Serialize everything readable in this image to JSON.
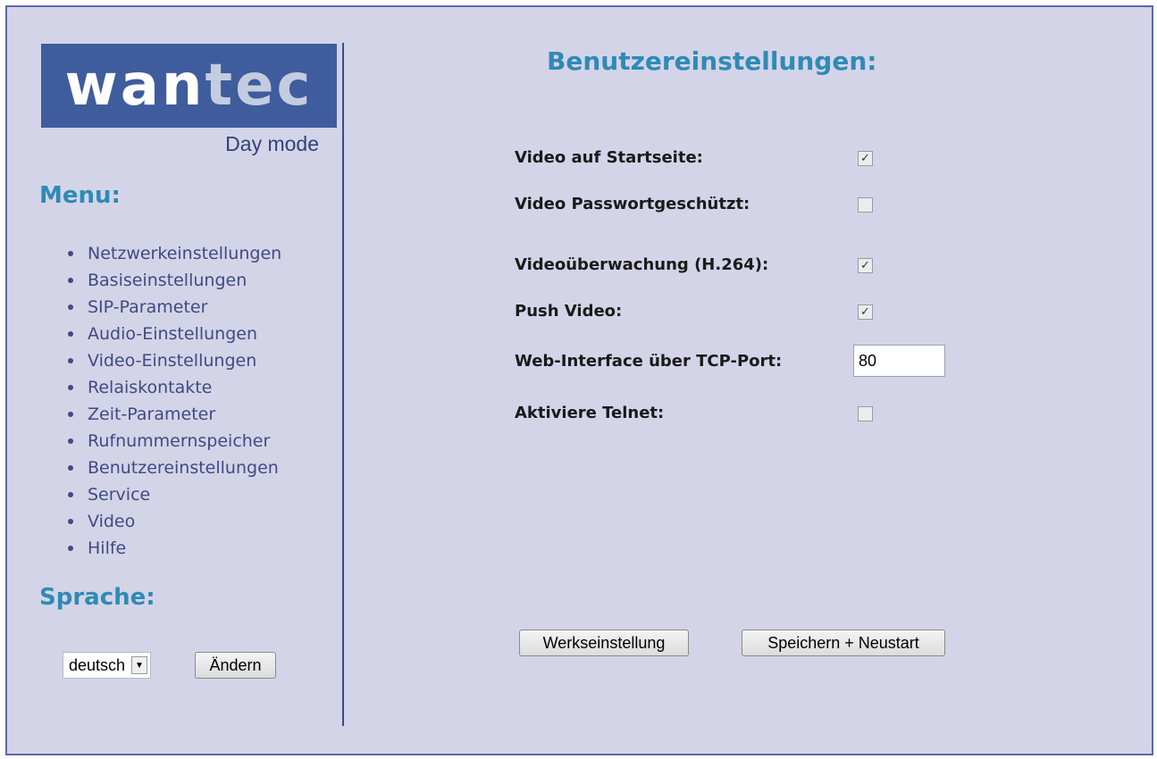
{
  "brand": {
    "logo_part1": "wan",
    "logo_part2": "tec",
    "mode": "Day mode"
  },
  "sidebar": {
    "menu_title": "Menu:",
    "items": [
      "Netzwerkeinstellungen",
      "Basiseinstellungen",
      "SIP-Parameter",
      "Audio-Einstellungen",
      "Video-Einstellungen",
      "Relaiskontakte",
      "Zeit-Parameter",
      "Rufnummernspeicher",
      "Benutzereinstellungen",
      "Service",
      "Video",
      "Hilfe"
    ],
    "language_title": "Sprache:",
    "language_value": "deutsch",
    "language_arrow": "▼",
    "change_label": "Ändern"
  },
  "main": {
    "title": "Benutzereinstellungen:",
    "settings": [
      {
        "label": "Video auf Startseite:",
        "checked": true
      },
      {
        "label": "Video Passwortgeschützt:",
        "checked": false
      },
      {
        "label": "Videoüberwachung (H.264):",
        "checked": true
      },
      {
        "label": "Push Video:",
        "checked": true
      },
      {
        "label": "Web-Interface über TCP-Port:",
        "value": "80"
      },
      {
        "label": "Aktiviere Telnet:",
        "checked": false
      }
    ],
    "checkmark": "✓",
    "factory_button": "Werkseinstellung",
    "save_button": "Speichern + Neustart"
  },
  "colors": {
    "background": "#d4d4e8",
    "border": "#5a6aa6",
    "accent": "#2f8ab6",
    "logo_bg": "#3f5c9c",
    "menu_text": "#404a82"
  }
}
